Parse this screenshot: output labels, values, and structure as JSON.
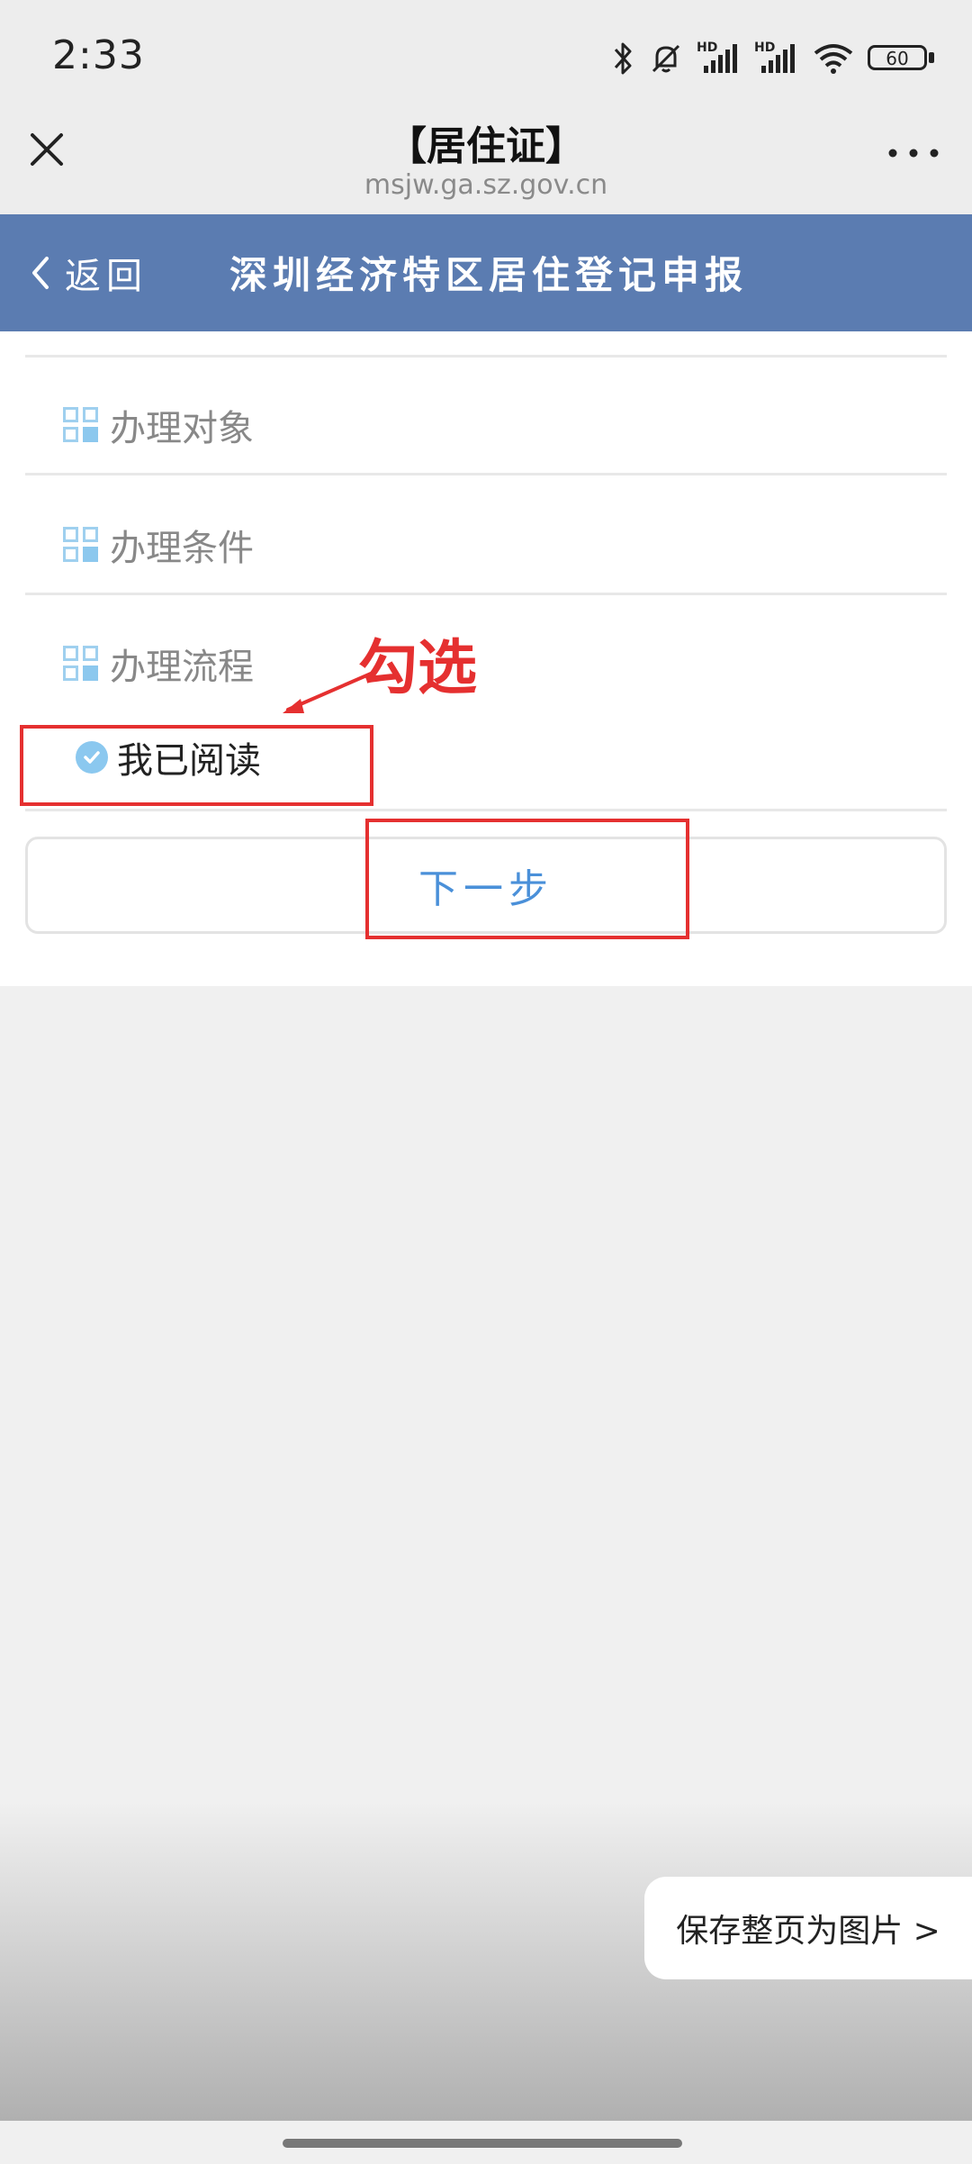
{
  "status_bar": {
    "time": "2:33",
    "battery": "60",
    "signal_label_1": "HD",
    "signal_label_2": "HD",
    "icons": [
      "bluetooth-icon",
      "mute-bell-icon",
      "signal-icon",
      "signal-icon",
      "wifi-icon",
      "battery-icon"
    ]
  },
  "browser": {
    "title": "【居住证】",
    "url": "msjw.ga.sz.gov.cn"
  },
  "header": {
    "back_label": "返回",
    "title": "深圳经济特区居住登记申报",
    "background": "#5b7cb1"
  },
  "sections": [
    {
      "label": "办理对象"
    },
    {
      "label": "办理条件"
    },
    {
      "label": "办理流程"
    }
  ],
  "agreement": {
    "label": "我已阅读",
    "checked": true
  },
  "next_button": {
    "label": "下一步"
  },
  "annotation": {
    "text": "勾选",
    "color": "#e53030"
  },
  "save_image": {
    "label": "保存整页为图片 >"
  }
}
